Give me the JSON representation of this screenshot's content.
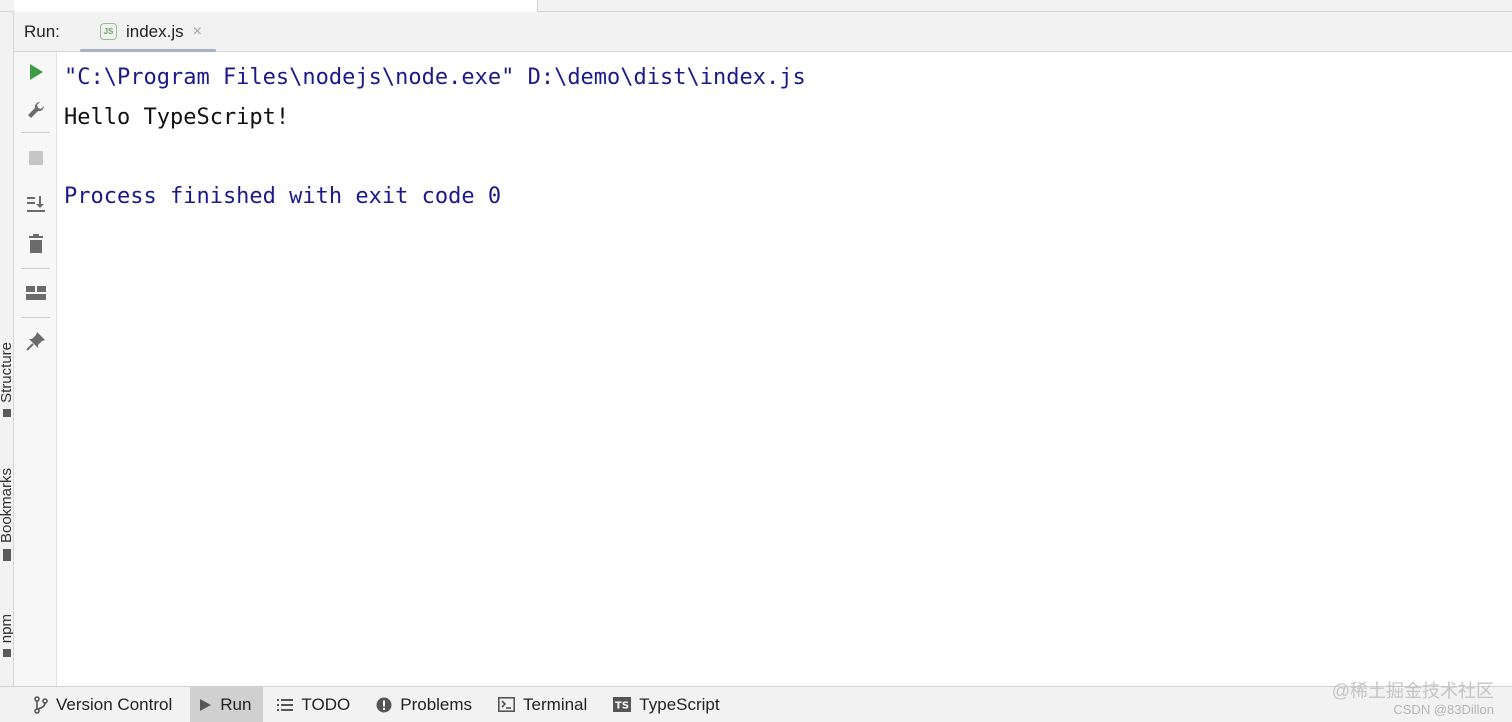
{
  "run_header": {
    "label": "Run:",
    "tab": {
      "title": "index.js",
      "icon": "nodejs-file-icon",
      "close": "×"
    }
  },
  "side_labels": {
    "structure": "Structure",
    "bookmarks": "Bookmarks",
    "npm": "npm"
  },
  "toolbar": {
    "icons": [
      "rerun-icon",
      "wrench-icon",
      "stop-icon",
      "scroll-to-end-icon",
      "trash-icon",
      "layout-icon",
      "pin-icon"
    ]
  },
  "console": {
    "lines": [
      "\"C:\\Program Files\\nodejs\\node.exe\" D:\\demo\\dist\\index.js",
      "Hello TypeScript!",
      "",
      "Process finished with exit code 0"
    ]
  },
  "bottom_bar": {
    "items": [
      {
        "label": "Version Control",
        "icon": "vcs-icon",
        "active": false
      },
      {
        "label": "Run",
        "icon": "run-icon",
        "active": true
      },
      {
        "label": "TODO",
        "icon": "list-icon",
        "active": false
      },
      {
        "label": "Problems",
        "icon": "warning-icon",
        "active": false
      },
      {
        "label": "Terminal",
        "icon": "terminal-icon",
        "active": false
      },
      {
        "label": "TypeScript",
        "icon": "ts-icon",
        "active": false
      }
    ]
  },
  "watermark": {
    "line1": "@稀土掘金技术社区",
    "line2": "CSDN @83Dillon"
  },
  "colors": {
    "run_green": "#3d9b45",
    "console_blue": "#1a1a8c",
    "icon_gray": "#6b6b6b"
  }
}
